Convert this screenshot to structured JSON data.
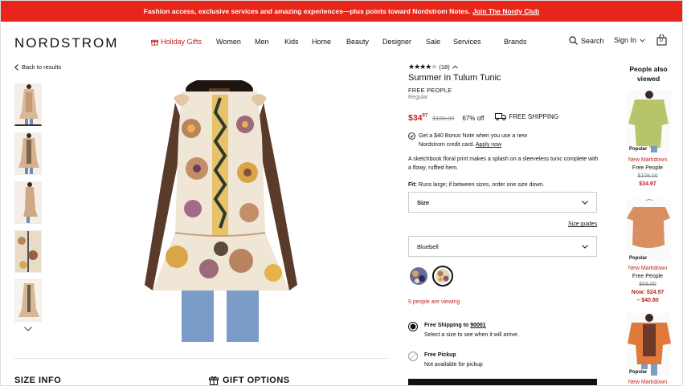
{
  "promo": {
    "text": "Fashion access, exclusive services and amazing experiences—plus points toward Nordstrom Notes.",
    "link": "Join The Nordy Club"
  },
  "header": {
    "logo": "NORDSTROM",
    "nav": [
      "Holiday Gifts",
      "Women",
      "Men",
      "Kids",
      "Home",
      "Beauty",
      "Designer",
      "Sale",
      "Services",
      "Brands"
    ],
    "search": "Search",
    "signin": "Sign In",
    "bag_count": "0"
  },
  "back_link": "Back to results",
  "product": {
    "review_count": "(18)",
    "rating": "4 of 5",
    "title": "Summer in Tulum Tunic",
    "brand": "FREE PEOPLE",
    "fit_type": "Regular",
    "price_dollars": "$34",
    "price_cents": "97",
    "original_price": "$108.00",
    "discount": "67% off",
    "shipping": "FREE SHIPPING",
    "bonus_line1": "Get a $40 Bonus Note when you use a new",
    "bonus_line2": "Nordstrom credit card.",
    "apply_link": "Apply now",
    "description": "A sketchbook floral print makes a splash on a sleeveless tunic complete with a flowy, ruffled hem.",
    "fit_label": "Fit:",
    "fit_text": "Runs large; if between sizes, order one size down.",
    "size_select": "Size",
    "size_guides": "Size guides",
    "color_select": "Bluebell",
    "viewing": "9 people are viewing",
    "ship_title": "Free Shipping to",
    "ship_zip": "90001",
    "ship_sub": "Select a size to see when it will arrive.",
    "pickup_title": "Free Pickup",
    "pickup_sub": "Not available for pickup"
  },
  "sections": {
    "size_info": "SIZE INFO",
    "gift_options": "GIFT OPTIONS"
  },
  "sidebar": {
    "title": "People also viewed",
    "items": [
      {
        "badge": "Popular",
        "tag": "New Markdown",
        "brand": "Free People",
        "was": "$108.00",
        "now": "$34.97"
      },
      {
        "badge": "Popular",
        "tag": "New Markdown",
        "brand": "Free People",
        "was": "$68.00",
        "now": "Now: $24.97",
        "now2": "– $40.80"
      },
      {
        "badge": "Popular",
        "tag": "New Markdown"
      }
    ]
  },
  "colors": {
    "accent": "#c0231e",
    "promo_bg": "#e8251a"
  }
}
